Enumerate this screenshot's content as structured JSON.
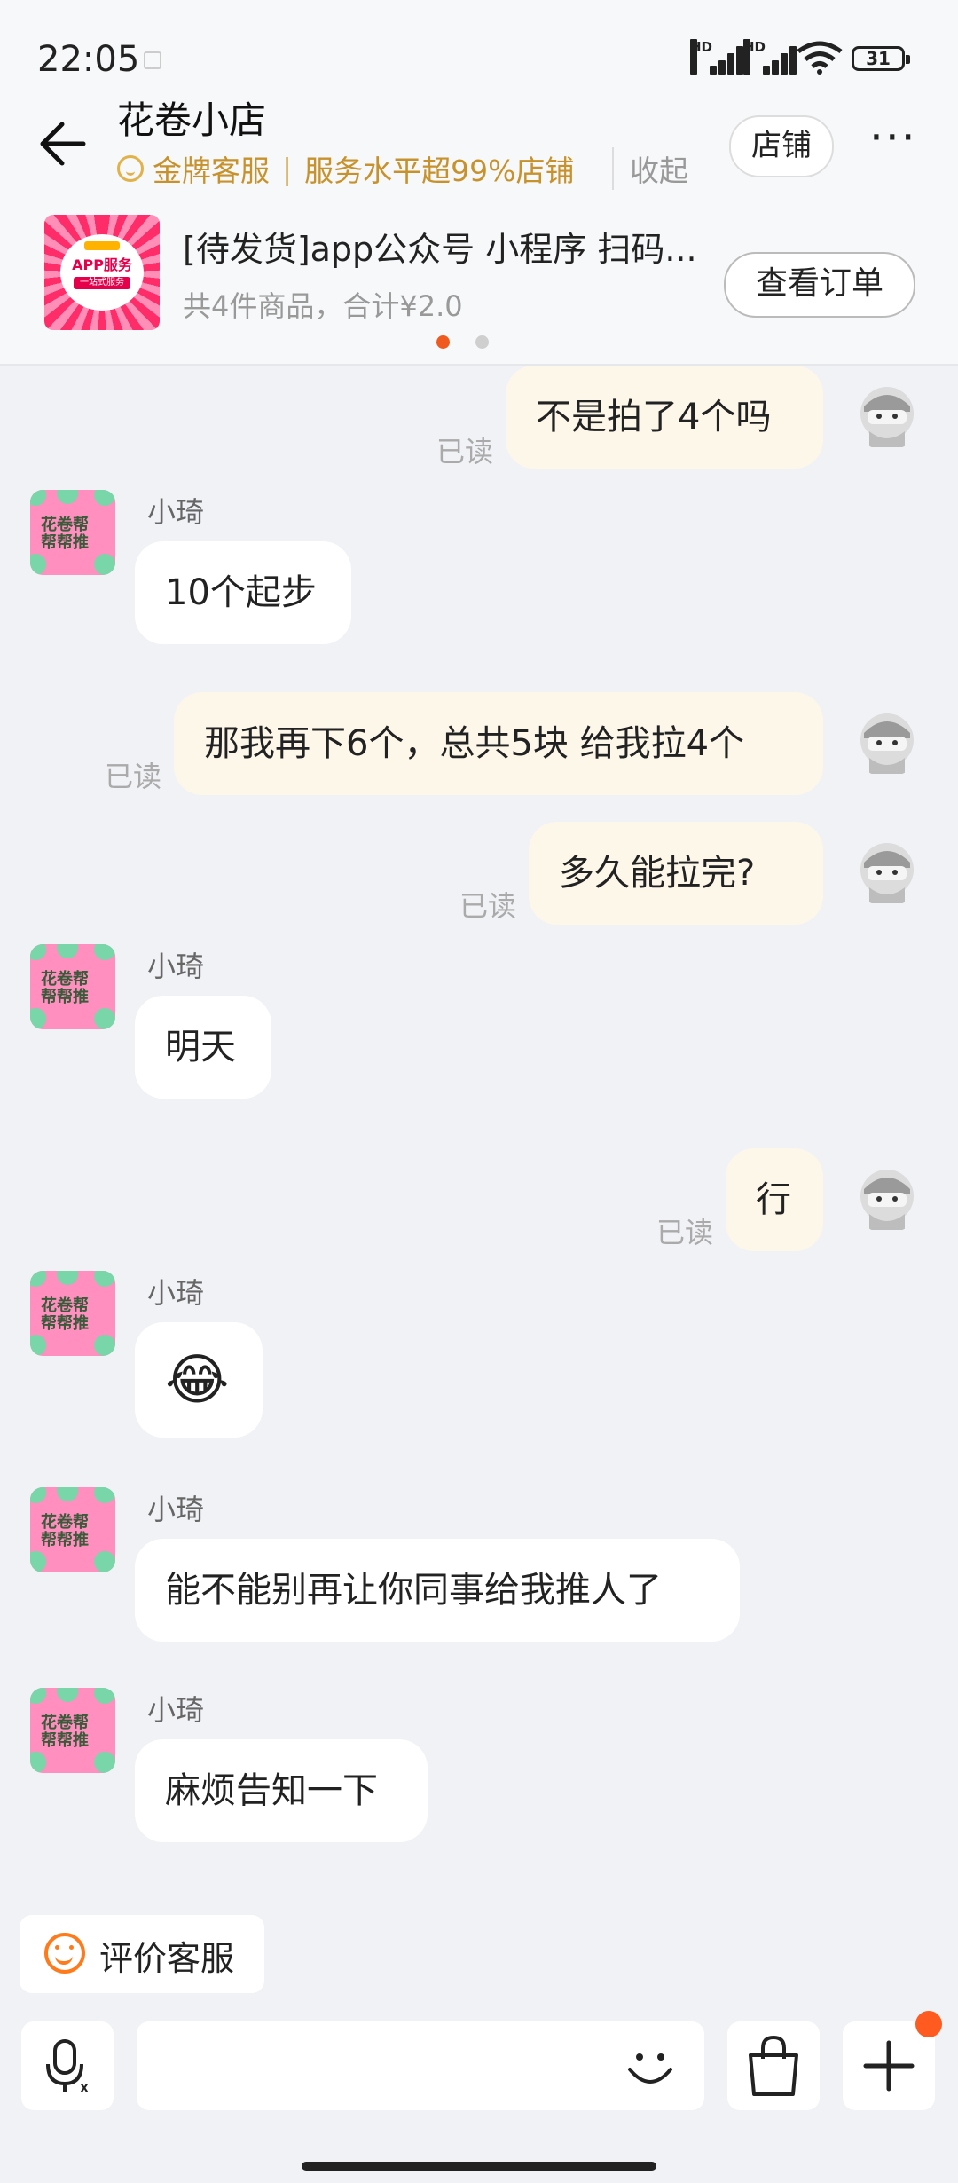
{
  "status_bar": {
    "time": "22:05",
    "hd1": "HD",
    "hd2": "HD",
    "battery": "31"
  },
  "header": {
    "shop_name": "花卷小店",
    "badge_gold": "金牌客服",
    "badge_sep": "|",
    "badge_service": "服务水平超99%店铺",
    "collapse": "收起",
    "store_button": "店铺",
    "more": "···"
  },
  "order": {
    "title": "[待发货]app公众号 小程序 扫码...",
    "summary": "共4件商品，合计¥2.0",
    "view_button": "查看订单",
    "thumb_app": "APP服务",
    "thumb_sub": "一站式服务",
    "dots_active": "#f05a1e",
    "dots_inactive": "#cfcfcf"
  },
  "messages": [
    {
      "from": "me",
      "text": "不是拍了4个吗",
      "read": "已读"
    },
    {
      "from": "other",
      "sender": "小琦",
      "text": "10个起步"
    },
    {
      "from": "me",
      "text": "那我再下6个，总共5块 给我拉4个",
      "read": "已读"
    },
    {
      "from": "me",
      "text": "多久能拉完?",
      "read": "已读"
    },
    {
      "from": "other",
      "sender": "小琦",
      "text": "明天"
    },
    {
      "from": "me",
      "text": "行",
      "read": "已读"
    },
    {
      "from": "other",
      "sender": "小琦",
      "text": "😂"
    },
    {
      "from": "other",
      "sender": "小琦",
      "text": "能不能别再让你同事给我推人了"
    },
    {
      "from": "other",
      "sender": "小琦",
      "text": "麻烦告知一下"
    }
  ],
  "avatar_text": "花卷帮\n帮帮推",
  "rate": {
    "label": "评价客服"
  },
  "colors": {
    "accent": "#ff5a1f",
    "gold": "#c7922c",
    "me_bubble": "#fdf7ea"
  }
}
